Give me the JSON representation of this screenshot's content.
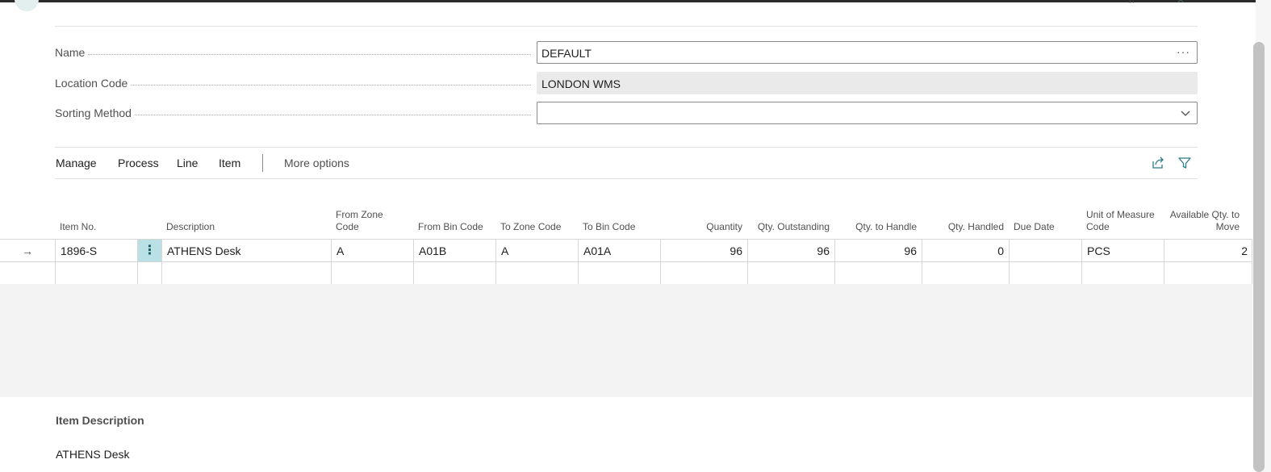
{
  "header": {
    "name_label": "Name",
    "name_value": "DEFAULT",
    "name_assist_label": "···",
    "location_label": "Location Code",
    "location_value": "LONDON WMS",
    "sorting_label": "Sorting Method",
    "sorting_value": ""
  },
  "actions": {
    "manage": "Manage",
    "process": "Process",
    "line": "Line",
    "item": "Item",
    "more": "More options",
    "share_icon": "share-icon",
    "filter_icon": "filter-icon"
  },
  "grid": {
    "columns": [
      {
        "key": "item_no",
        "label": "Item No."
      },
      {
        "key": "description",
        "label": "Description"
      },
      {
        "key": "from_zone",
        "label": "From Zone Code"
      },
      {
        "key": "from_bin",
        "label": "From Bin Code"
      },
      {
        "key": "to_zone",
        "label": "To Zone Code"
      },
      {
        "key": "to_bin",
        "label": "To Bin Code"
      },
      {
        "key": "quantity",
        "label": "Quantity"
      },
      {
        "key": "qty_outstanding",
        "label": "Qty. Outstanding"
      },
      {
        "key": "qty_to_handle",
        "label": "Qty. to Handle"
      },
      {
        "key": "qty_handled",
        "label": "Qty. Handled"
      },
      {
        "key": "due_date",
        "label": "Due Date"
      },
      {
        "key": "uom",
        "label": "Unit of Measure Code"
      },
      {
        "key": "available_qty",
        "label": "Available Qty. to Move"
      }
    ],
    "rows": [
      {
        "arrow": "→",
        "menu": "⋮",
        "item_no": "1896-S",
        "description": "ATHENS Desk",
        "from_zone": "A",
        "from_bin": "A01B",
        "to_zone": "A",
        "to_bin": "A01A",
        "quantity": "96",
        "qty_outstanding": "96",
        "qty_to_handle": "96",
        "qty_handled": "0",
        "due_date": "",
        "uom": "PCS",
        "available_qty": "2"
      },
      {
        "arrow": "",
        "menu": "",
        "item_no": "",
        "description": "",
        "from_zone": "",
        "from_bin": "",
        "to_zone": "",
        "to_bin": "",
        "quantity": "",
        "qty_outstanding": "",
        "qty_to_handle": "",
        "qty_handled": "",
        "due_date": "",
        "uom": "",
        "available_qty": ""
      }
    ]
  },
  "factbox": {
    "title": "Item Description",
    "value": "ATHENS Desk"
  },
  "colors": {
    "selected_row_menu": "#b9e1e5",
    "readonly_field": "#eaeaea",
    "accent": "#2b7a87"
  }
}
